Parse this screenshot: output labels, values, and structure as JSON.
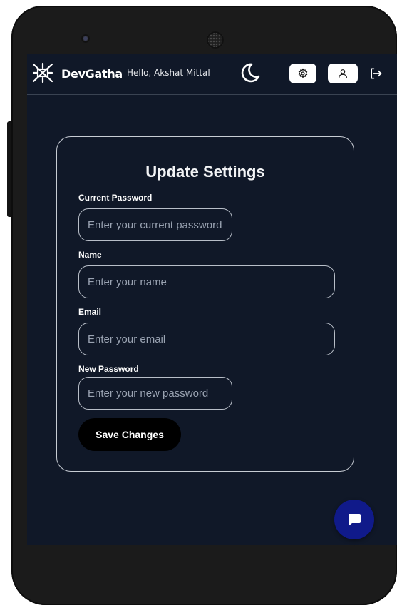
{
  "navbar": {
    "brand": "DevGatha",
    "greeting": "Hello, Akshat Mittal",
    "icons": {
      "logo": "devgatha-logo-icon",
      "theme": "moon-icon",
      "settings": "gear-icon",
      "profile": "user-icon",
      "logout": "logout-icon"
    }
  },
  "form": {
    "title": "Update Settings",
    "fields": [
      {
        "label": "Current Password",
        "placeholder": "Enter your current password",
        "value": ""
      },
      {
        "label": "Name",
        "placeholder": "Enter your name",
        "value": ""
      },
      {
        "label": "Email",
        "placeholder": "Enter your email",
        "value": ""
      },
      {
        "label": "New Password",
        "placeholder": "Enter your new password",
        "value": ""
      }
    ],
    "submit_label": "Save Changes"
  },
  "chat": {
    "icon": "chat-bubble-icon"
  },
  "colors": {
    "screen_bg": "#101828",
    "card_border": "#c7ccd4",
    "button_bg": "#000000",
    "chat_fab": "#101a8a"
  }
}
